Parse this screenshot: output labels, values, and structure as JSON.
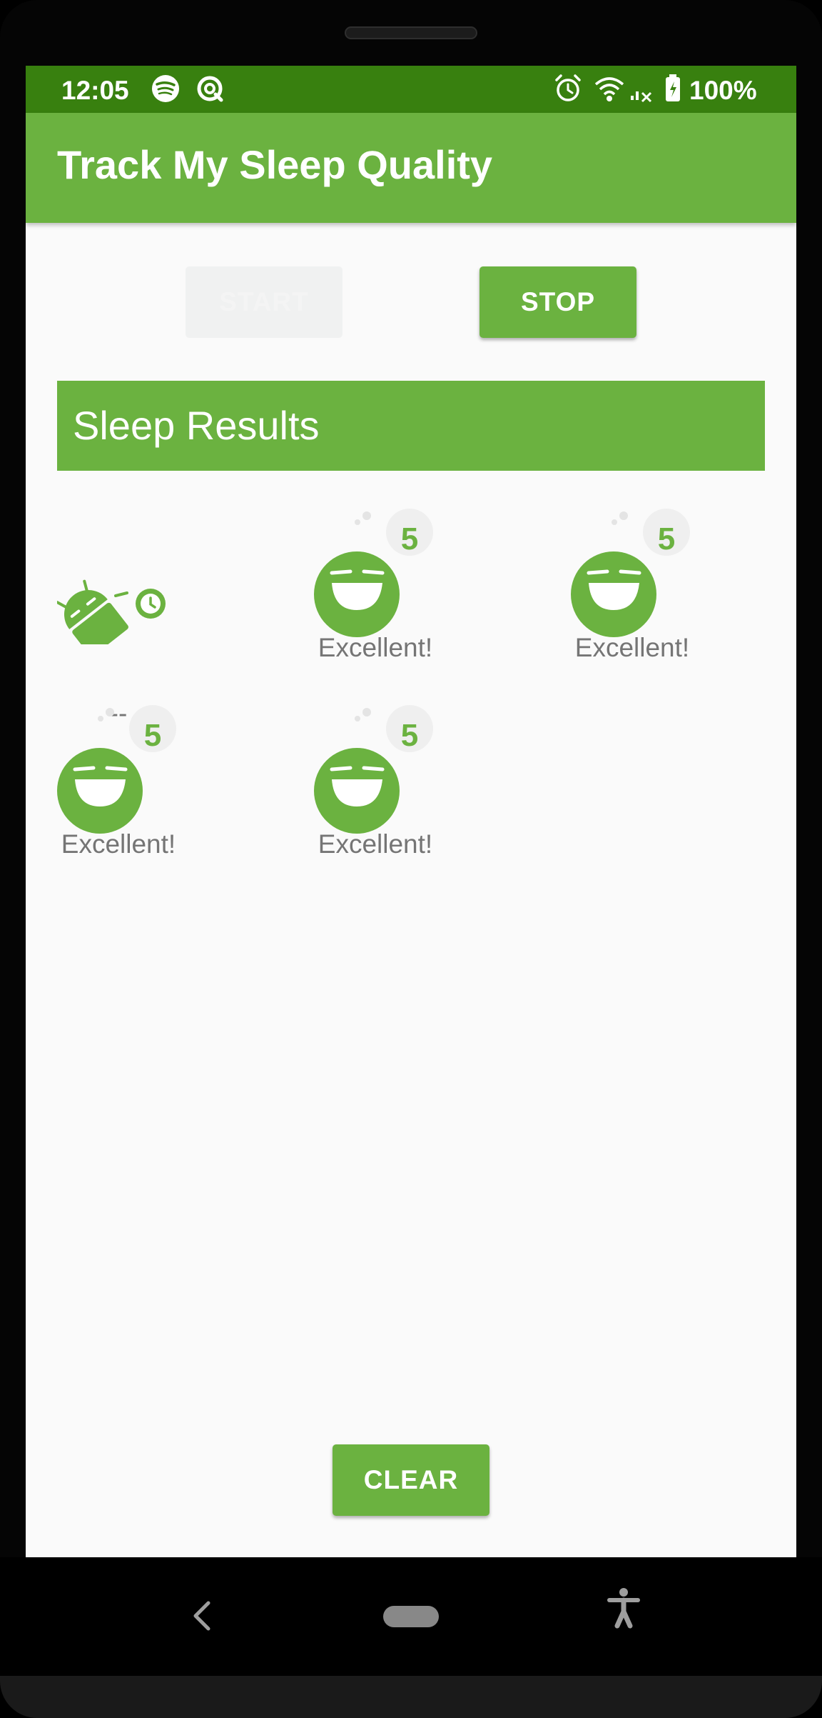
{
  "status_bar": {
    "time": "12:05",
    "battery": "100%",
    "left_icons": [
      "spotify-icon",
      "sync-icon"
    ],
    "right_icons": [
      "alarm-icon",
      "wifi-icon",
      "signal-icon",
      "battery-icon"
    ]
  },
  "app_bar": {
    "title": "Track My Sleep Quality"
  },
  "buttons": {
    "start": "START",
    "stop": "STOP",
    "clear": "CLEAR"
  },
  "results": {
    "title": "Sleep Results",
    "items": [
      {
        "icon": "sleep-active-icon",
        "label": "--"
      },
      {
        "icon": "sleep-5-icon",
        "score": "5",
        "label": "Excellent!"
      },
      {
        "icon": "sleep-5-icon",
        "score": "5",
        "label": "Excellent!"
      },
      {
        "icon": "sleep-5-icon",
        "score": "5",
        "label": "Excellent!"
      },
      {
        "icon": "sleep-5-icon",
        "score": "5",
        "label": "Excellent!"
      }
    ]
  },
  "nav_bar": {
    "icons": [
      "back-icon",
      "home-pill-icon",
      "accessibility-icon"
    ]
  },
  "colors": {
    "primary": "#6bb240",
    "status_bar": "#38800f",
    "background": "#fafafa",
    "label": "#757575"
  }
}
